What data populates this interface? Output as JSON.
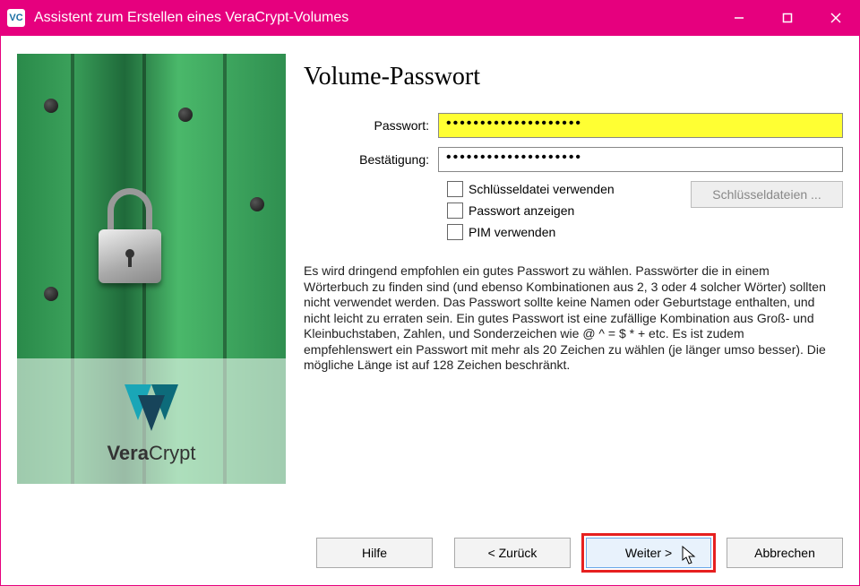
{
  "titlebar": {
    "title": "Assistent zum Erstellen eines VeraCrypt-Volumes"
  },
  "sidebar": {
    "product_name_bold": "Vera",
    "product_name_rest": "Crypt"
  },
  "main": {
    "heading": "Volume-Passwort",
    "password_label": "Passwort:",
    "confirm_label": "Bestätigung:",
    "password_mask": "••••••••••••••••••••",
    "confirm_mask": "••••••••••••••••••••",
    "checkboxes": {
      "use_keyfiles": "Schlüsseldatei verwenden",
      "show_password": "Passwort anzeigen",
      "use_pim": "PIM verwenden"
    },
    "keyfiles_button": "Schlüsseldateien ...",
    "advice_text": "Es wird dringend empfohlen ein gutes Passwort zu wählen. Passwörter die in einem Wörterbuch zu finden sind (und ebenso Kombinationen aus 2, 3 oder 4 solcher Wörter) sollten nicht verwendet werden. Das Passwort sollte keine Namen oder Geburtstage enthalten, und nicht leicht zu erraten sein. Ein gutes Passwort ist eine zufällige Kombination aus Groß- und Kleinbuchstaben, Zahlen, und Sonderzeichen wie @ ^ = $ * + etc. Es ist zudem empfehlenswert ein Passwort mit mehr als 20 Zeichen zu wählen (je länger umso besser). Die mögliche Länge ist auf 128 Zeichen beschränkt."
  },
  "buttons": {
    "help": "Hilfe",
    "back": "< Zurück",
    "next": "Weiter >",
    "cancel": "Abbrechen"
  }
}
